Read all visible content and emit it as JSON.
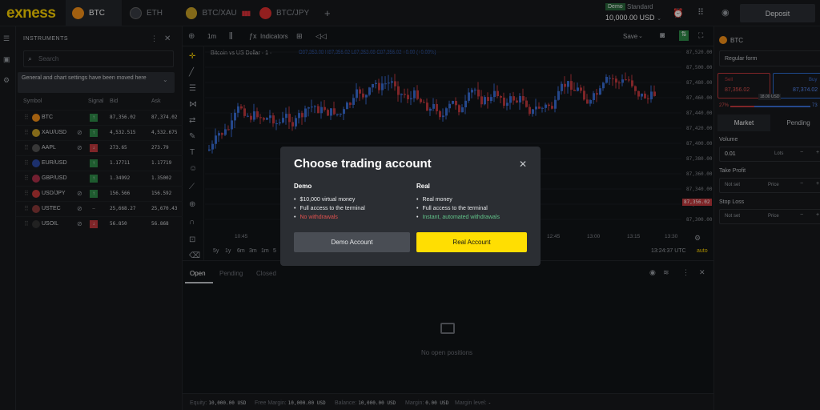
{
  "topbar": {
    "logo": "exness",
    "tabs": [
      {
        "label": "BTC",
        "icon": "btc-coin-icon"
      },
      {
        "label": "ETH",
        "icon": "eth-coin-icon"
      },
      {
        "label": "BTC/XAU",
        "icon": "btc-xau-pair-icon"
      },
      {
        "label": "BTC/JPY",
        "icon": "btc-jpy-pair-icon"
      }
    ],
    "add_tab": "+",
    "account_mode": "Demo",
    "account_type": "Standard",
    "balance": "10,000.00 USD",
    "deposit": "Deposit"
  },
  "instruments": {
    "title": "INSTRUMENTS",
    "search_placeholder": "Search",
    "tooltip": "General and chart settings have been moved here",
    "columns": [
      "Symbol",
      "Signal",
      "Bid",
      "Ask"
    ],
    "rows": [
      {
        "symbol": "BTC",
        "signal": "up",
        "bid": "87,356.02",
        "ask": "87,374.02",
        "color": "#f7931a"
      },
      {
        "symbol": "XAU/USD",
        "signal": "up",
        "bid": "4,532.515",
        "ask": "4,532.675",
        "color": "#c9a227"
      },
      {
        "symbol": "AAPL",
        "signal": "down",
        "bid": "273.65",
        "ask": "273.79",
        "color": "#555555"
      },
      {
        "symbol": "EUR/USD",
        "signal": "up",
        "bid": "1.17711",
        "ask": "1.17719",
        "color": "#2b4aa8"
      },
      {
        "symbol": "GBP/USD",
        "signal": "up",
        "bid": "1.34992",
        "ask": "1.35002",
        "color": "#b0304a"
      },
      {
        "symbol": "USD/JPY",
        "signal": "up",
        "bid": "156.566",
        "ask": "156.592",
        "color": "#c63a3a"
      },
      {
        "symbol": "USTEC",
        "signal": "none",
        "bid": "25,668.27",
        "ask": "25,670.43",
        "color": "#8a3a3a"
      },
      {
        "symbol": "USOIL",
        "signal": "down",
        "bid": "56.850",
        "ask": "56.868",
        "color": "#333333"
      }
    ]
  },
  "chart": {
    "interval": "1m",
    "indicators": "Indicators",
    "save": "Save",
    "title": "Bitcoin vs US Dollar · 1 ·",
    "ohlc": "O87,353.08 H87,356.02 L87,353.08 C87,356.02 +0.00 (+0.00%)",
    "price_tag": "87,356.02",
    "time": "13:24:37 UTC",
    "auto": "auto",
    "timeframes": [
      "5y",
      "1y",
      "6m",
      "3m",
      "1m",
      "5"
    ]
  },
  "chart_data": {
    "type": "candlestick",
    "ylim": [
      87300,
      87530
    ],
    "yticks": [
      "87,520.00",
      "87,500.00",
      "87,480.00",
      "87,460.00",
      "87,440.00",
      "87,420.00",
      "87,400.00",
      "87,380.00",
      "87,360.00",
      "87,340.00",
      "87,320.00",
      "87,300.00"
    ],
    "xticks": [
      "10:45",
      "12:45",
      "13:00",
      "13:15",
      "13:30"
    ]
  },
  "positions": {
    "tabs": [
      "Open",
      "Pending",
      "Closed"
    ],
    "empty": "No open positions"
  },
  "status": {
    "equity_label": "Equity:",
    "equity": "10,000.00 USD",
    "free_margin_label": "Free Margin:",
    "free_margin": "10,000.00 USD",
    "balance_label": "Balance:",
    "balance": "10,000.00 USD",
    "margin_label": "Margin:",
    "margin": "0.00 USD",
    "margin_level_label": "Margin level:",
    "margin_level": "-"
  },
  "order_panel": {
    "symbol": "BTC",
    "form": "Regular form",
    "sell_label": "Sell",
    "sell_price": "87,356.02",
    "buy_label": "Buy",
    "buy_price": "87,374.02",
    "spread": "18.00 USD",
    "sell_pct": "27%",
    "buy_pct": "73",
    "market": "Market",
    "pending": "Pending",
    "volume_label": "Volume",
    "volume": "0.01",
    "lots": "Lots",
    "tp_label": "Take Profit",
    "sl_label": "Stop Loss",
    "not_set": "Not set",
    "price": "Price"
  },
  "modal": {
    "title": "Choose trading account",
    "demo_heading": "Demo",
    "demo_items": [
      "$10,000 virtual money",
      "Full access to the terminal",
      "No withdrawals"
    ],
    "real_heading": "Real",
    "real_items": [
      "Real money",
      "Full access to the terminal",
      "Instant, automated withdrawals"
    ],
    "demo_button": "Demo Account",
    "real_button": "Real Account"
  }
}
